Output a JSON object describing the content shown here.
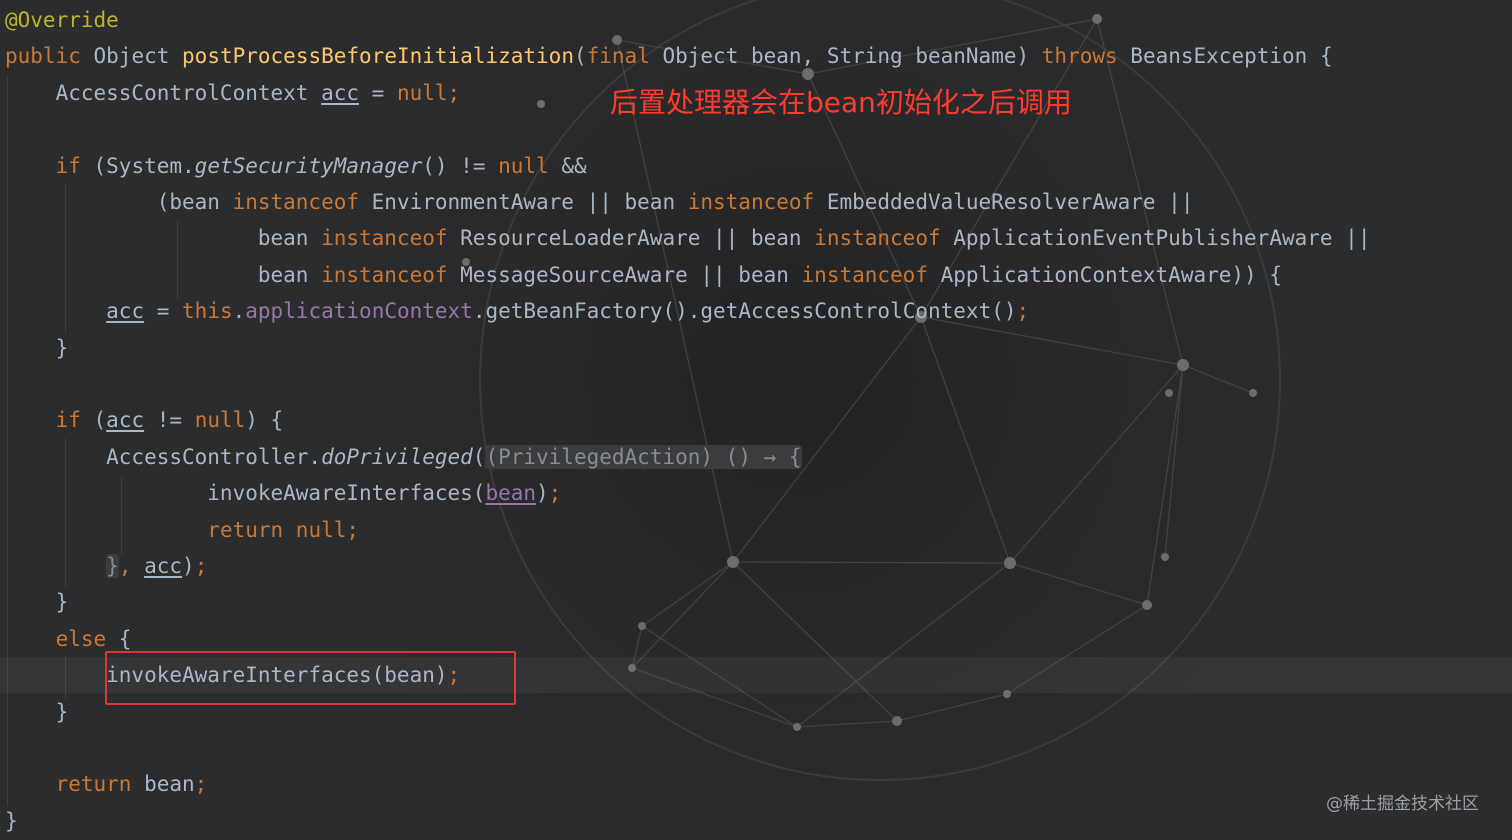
{
  "editor": {
    "theme_colors": {
      "background": "#2a2b2d",
      "default_text": "#a9b7c6",
      "keyword": "#cc7832",
      "method_declaration": "#ffc66d",
      "annotation": "#bbb529",
      "field": "#9876aa",
      "highlight_box": "#e0362f",
      "annotation_text": "#ff3b2f"
    },
    "lines": [
      [
        {
          "t": "@Override",
          "c": "ann"
        }
      ],
      [
        {
          "t": "public ",
          "c": "kw"
        },
        {
          "t": "Object "
        },
        {
          "t": "postProcessBeforeInitialization",
          "c": "fn"
        },
        {
          "t": "("
        },
        {
          "t": "final ",
          "c": "kw"
        },
        {
          "t": "Object bean, String beanName) "
        },
        {
          "t": "throws ",
          "c": "kw"
        },
        {
          "t": "BeansException {"
        }
      ],
      [
        {
          "t": "    AccessControlContext "
        },
        {
          "t": "acc",
          "c": "ul"
        },
        {
          "t": " = "
        },
        {
          "t": "null",
          "c": "kw"
        },
        {
          "t": ";",
          "c": "kw"
        }
      ],
      [],
      [
        {
          "t": "    "
        },
        {
          "t": "if ",
          "c": "kw"
        },
        {
          "t": "(System."
        },
        {
          "t": "getSecurityManager",
          "c": "it"
        },
        {
          "t": "() != "
        },
        {
          "t": "null ",
          "c": "kw"
        },
        {
          "t": "&&"
        }
      ],
      [
        {
          "t": "            (bean "
        },
        {
          "t": "instanceof ",
          "c": "kw"
        },
        {
          "t": "EnvironmentAware || bean "
        },
        {
          "t": "instanceof ",
          "c": "kw"
        },
        {
          "t": "EmbeddedValueResolverAware ||"
        }
      ],
      [
        {
          "t": "                    bean "
        },
        {
          "t": "instanceof ",
          "c": "kw"
        },
        {
          "t": "ResourceLoaderAware || bean "
        },
        {
          "t": "instanceof ",
          "c": "kw"
        },
        {
          "t": "ApplicationEventPublisherAware ||"
        }
      ],
      [
        {
          "t": "                    bean "
        },
        {
          "t": "instanceof ",
          "c": "kw"
        },
        {
          "t": "MessageSourceAware || bean "
        },
        {
          "t": "instanceof ",
          "c": "kw"
        },
        {
          "t": "ApplicationContextAware)) {"
        }
      ],
      [
        {
          "t": "        "
        },
        {
          "t": "acc",
          "c": "ul"
        },
        {
          "t": " = "
        },
        {
          "t": "this",
          "c": "kw"
        },
        {
          "t": "."
        },
        {
          "t": "applicationContext",
          "c": "fld"
        },
        {
          "t": ".getBeanFactory().getAccessControlContext()"
        },
        {
          "t": ";",
          "c": "kw"
        }
      ],
      [
        {
          "t": "    }"
        }
      ],
      [],
      [
        {
          "t": "    "
        },
        {
          "t": "if ",
          "c": "kw"
        },
        {
          "t": "("
        },
        {
          "t": "acc",
          "c": "ul"
        },
        {
          "t": " != "
        },
        {
          "t": "null",
          "c": "kw"
        },
        {
          "t": ") {"
        }
      ],
      [
        {
          "t": "        AccessController."
        },
        {
          "t": "doPrivileged",
          "c": "it"
        },
        {
          "t": "("
        },
        {
          "t": "(PrivilegedAction) () → {",
          "c": "hint"
        }
      ],
      [
        {
          "t": "                invokeAwareInterfaces("
        },
        {
          "t": "bean",
          "c": "fld ul"
        },
        {
          "t": ")"
        },
        {
          "t": ";",
          "c": "kw"
        }
      ],
      [
        {
          "t": "                "
        },
        {
          "t": "return null;",
          "c": "kw"
        }
      ],
      [
        {
          "t": "        "
        },
        {
          "t": "}",
          "c": "hint"
        },
        {
          "t": ", ",
          "c": "kw"
        },
        {
          "t": "acc",
          "c": "ul"
        },
        {
          "t": ")"
        },
        {
          "t": ";",
          "c": "kw"
        }
      ],
      [
        {
          "t": "    }"
        }
      ],
      [
        {
          "t": "    "
        },
        {
          "t": "else ",
          "c": "kw"
        },
        {
          "t": "{"
        }
      ],
      [
        {
          "t": "        invokeAwareInterfaces(bean)"
        },
        {
          "t": ";",
          "c": "kw"
        }
      ],
      [
        {
          "t": "    }"
        }
      ],
      [],
      [
        {
          "t": "    "
        },
        {
          "t": "return ",
          "c": "kw"
        },
        {
          "t": "bean"
        },
        {
          "t": ";",
          "c": "kw"
        }
      ],
      [
        {
          "t": "}"
        }
      ]
    ],
    "current_line_index": 18
  },
  "annotation": {
    "text": "后置处理器会在bean初始化之后调用"
  },
  "watermark": {
    "text": "@稀土掘金技术社区"
  }
}
